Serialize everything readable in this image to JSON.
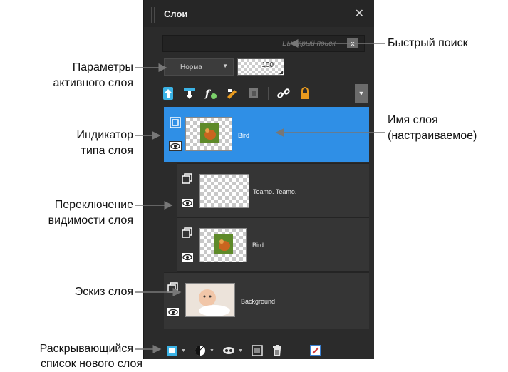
{
  "panel": {
    "title": "Слои",
    "search": {
      "placeholder": "Быстрый поиск",
      "clear_label": "x"
    },
    "blend_mode": "Норма",
    "opacity": "100"
  },
  "toolbar": {
    "icons": [
      "move-layer-up-icon",
      "move-layer-down-icon",
      "layer-effects-icon",
      "edit-layer-icon",
      "group-layers-icon",
      "link-layers-icon",
      "lock-layer-icon"
    ]
  },
  "layers": [
    {
      "name": "Bird",
      "selected": true,
      "visible": true,
      "type": "raster"
    },
    {
      "name": "Teamo. Teamo.",
      "selected": false,
      "visible": true,
      "type": "raster"
    },
    {
      "name": "Bird",
      "selected": false,
      "visible": true,
      "type": "raster"
    },
    {
      "name": "Background",
      "selected": false,
      "visible": true,
      "type": "background"
    }
  ],
  "bottom_toolbar": {
    "icons": [
      "new-layer-icon",
      "adjustment-layer-icon",
      "mask-icon",
      "frame-icon",
      "delete-icon",
      "properties-icon"
    ]
  },
  "callouts": {
    "quick_search": "Быстрый поиск",
    "active_layer_params_1": "Параметры",
    "active_layer_params_2": "активного слоя",
    "layer_name_1": "Имя слоя",
    "layer_name_2": "(настраиваемое)",
    "layer_type_1": "Индикатор",
    "layer_type_2": "типа слоя",
    "visibility_1": "Переключение",
    "visibility_2": "видимости слоя",
    "thumbnail": "Эскиз слоя",
    "new_layer_1": "Раскрывающийся",
    "new_layer_2": "список нового слоя"
  },
  "colors": {
    "panel_bg": "#2b2b2b",
    "selection": "#2f8fe6",
    "icon_accent": "#3bb3e6",
    "icon_orange": "#e89a1e"
  }
}
